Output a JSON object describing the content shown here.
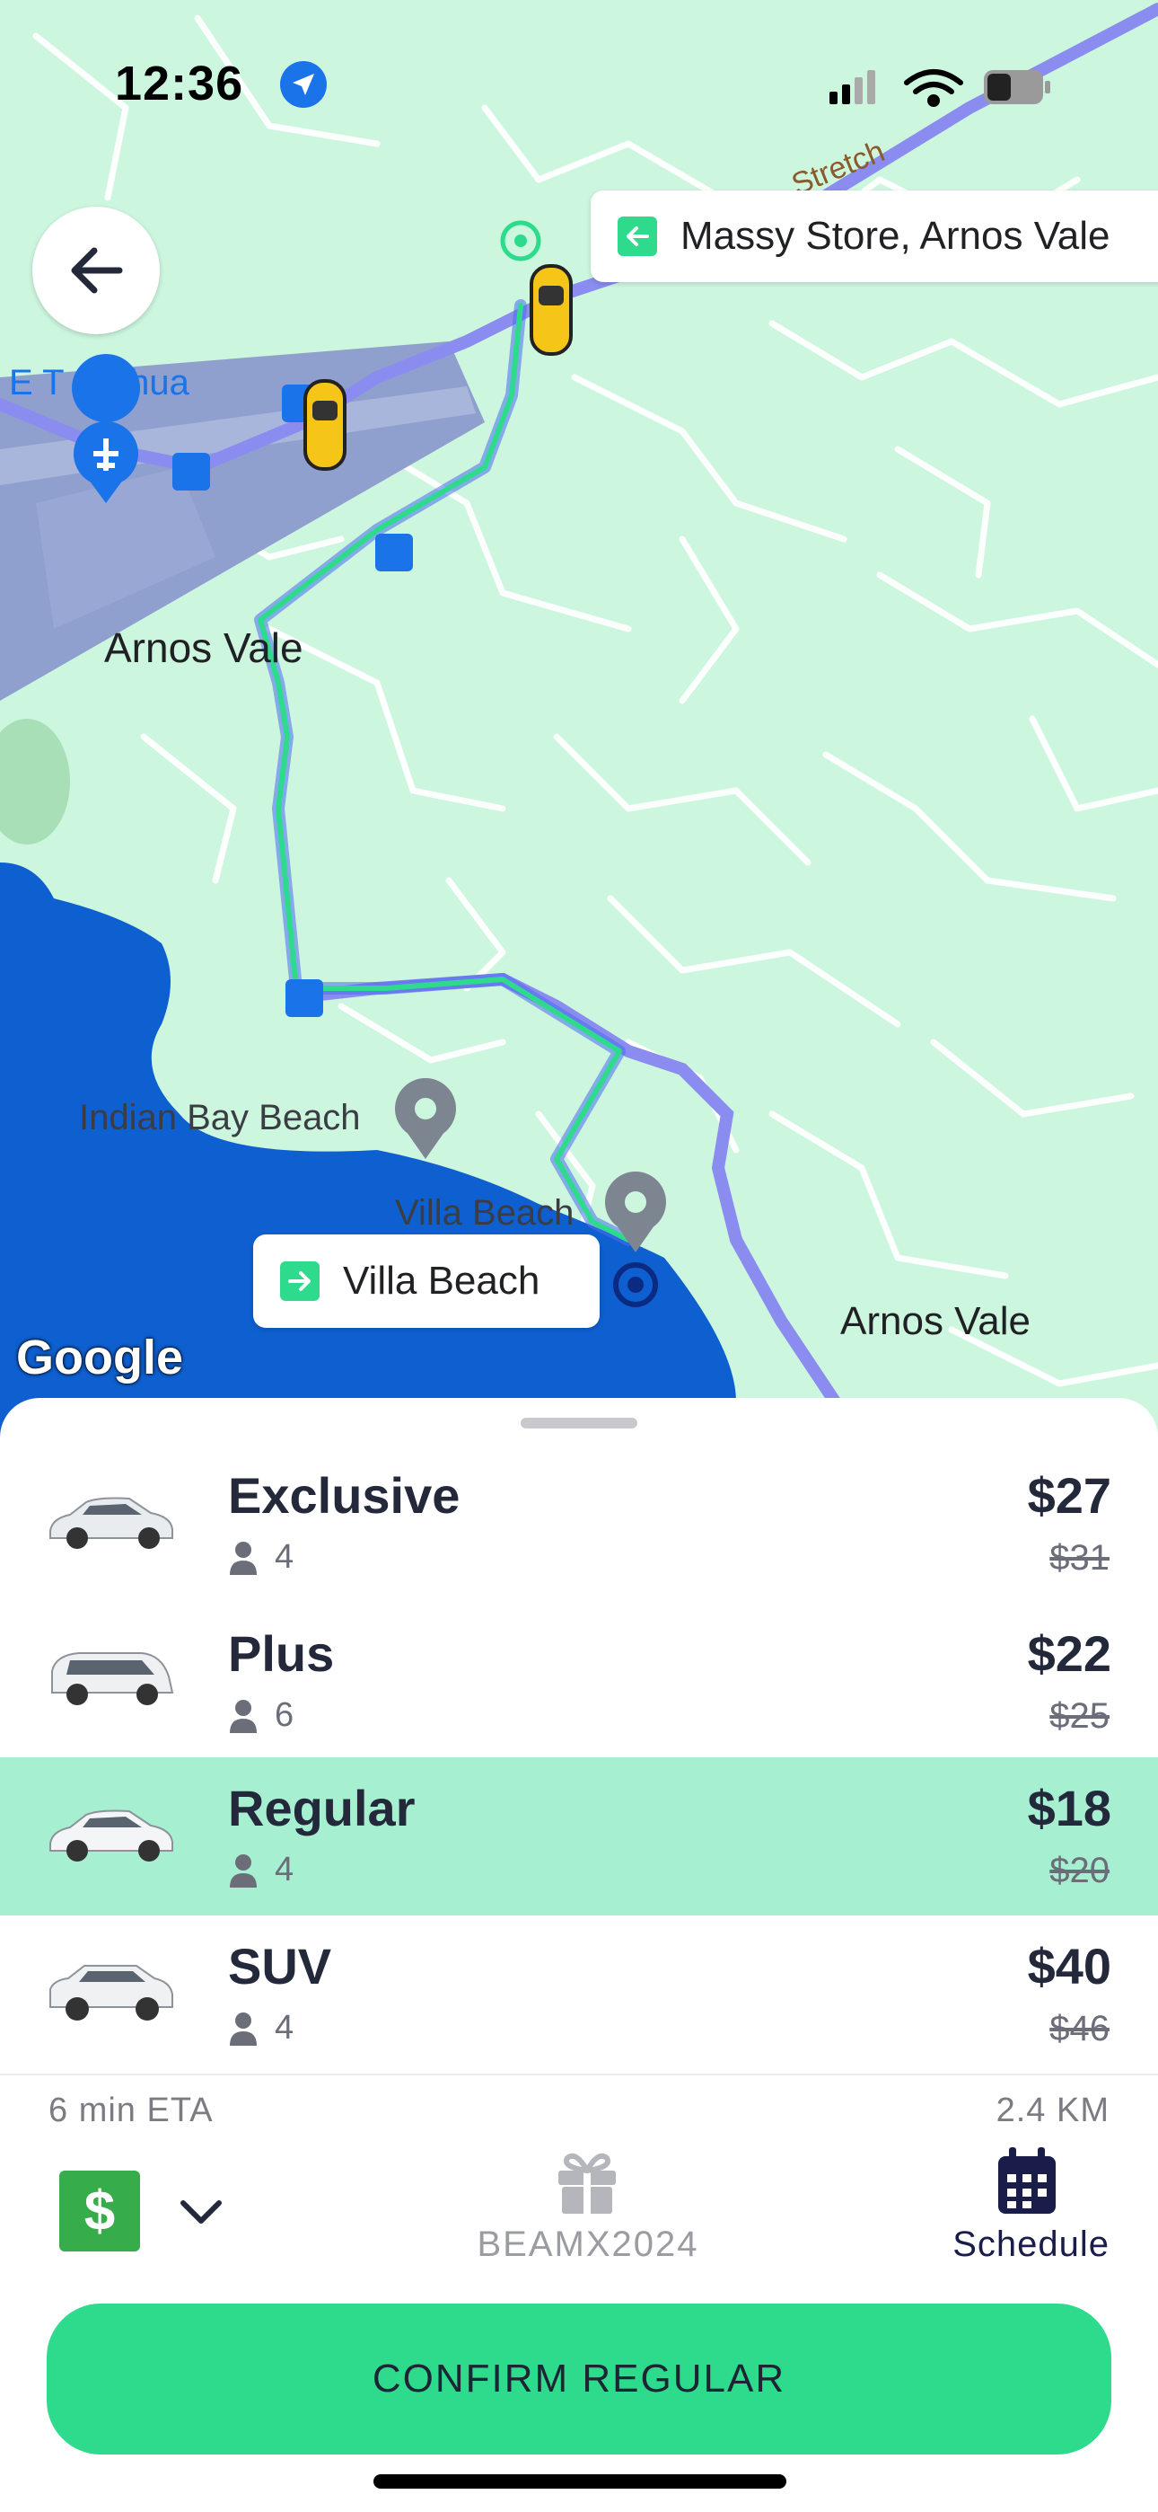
{
  "status_bar": {
    "time": "12:36"
  },
  "map": {
    "labels": {
      "et_joshua": "E T Joshua",
      "arnos_vale_1": "Arnos Vale",
      "arnos_vale_2": "Arnos Vale",
      "indian_bay": "Indian Bay Beach",
      "villa_beach": "Villa Beach",
      "stretch": "Stretch",
      "google": "Google"
    },
    "pickup_chip": "Massy Store, Arnos Vale",
    "dropoff_chip": "Villa Beach",
    "colors": {
      "land": "#cdf6df",
      "water": "#0e5fd0",
      "route_blue": "#8a8cf0",
      "route_green": "#2edb8c"
    }
  },
  "rides": [
    {
      "name": "Exclusive",
      "seats": "4",
      "price": "$27",
      "old_price": "$31",
      "selected": false
    },
    {
      "name": "Plus",
      "seats": "6",
      "price": "$22",
      "old_price": "$25",
      "selected": false
    },
    {
      "name": "Regular",
      "seats": "4",
      "price": "$18",
      "old_price": "$20",
      "selected": true
    },
    {
      "name": "SUV",
      "seats": "4",
      "price": "$40",
      "old_price": "$46",
      "selected": false
    }
  ],
  "trip": {
    "eta": "6 min ETA",
    "distance": "2.4 KM"
  },
  "payment": {
    "symbol": "$"
  },
  "promo": {
    "code": "BEAMX2024"
  },
  "schedule": {
    "label": "Schedule"
  },
  "confirm_button": {
    "label": "CONFIRM REGULAR"
  },
  "accent_color": "#2edb8c"
}
